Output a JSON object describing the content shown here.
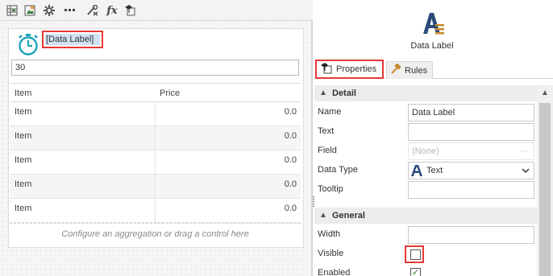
{
  "toolbar": {
    "icons": [
      "table-icon",
      "edit-image-icon",
      "gear-icon",
      "ellipsis-icon",
      "tools-icon",
      "fx-icon",
      "properties-icon"
    ],
    "fx_label": "fx"
  },
  "form": {
    "data_label_text": "[Data Label]",
    "number_value": "30",
    "grid": {
      "headers": [
        "Item",
        "Price"
      ],
      "rows": [
        {
          "item": "Item",
          "price": "0.0"
        },
        {
          "item": "Item",
          "price": "0.0"
        },
        {
          "item": "Item",
          "price": "0.0"
        },
        {
          "item": "Item",
          "price": "0.0"
        },
        {
          "item": "Item",
          "price": "0.0"
        }
      ],
      "footer": "Configure an aggregation or drag a control here"
    }
  },
  "properties_pane": {
    "control_title": "Data Label",
    "tabs": [
      "Properties",
      "Rules"
    ],
    "sections": {
      "detail": "Detail",
      "general": "General"
    },
    "fields": {
      "name_label": "Name",
      "name_value": "Data Label",
      "text_label": "Text",
      "field_label": "Field",
      "field_value": "(None)",
      "field_ellipsis": "···",
      "data_type_label": "Data Type",
      "data_type_value": "Text",
      "tooltip_label": "Tooltip",
      "width_label": "Width",
      "visible_label": "Visible",
      "visible_checked": false,
      "enabled_label": "Enabled",
      "enabled_checked": true
    }
  },
  "colors": {
    "highlight": "#e53935",
    "accent_teal": "#1aa3b8",
    "label_selection": "#cfe1f3",
    "datatype_icon": "#2b4a7a"
  }
}
